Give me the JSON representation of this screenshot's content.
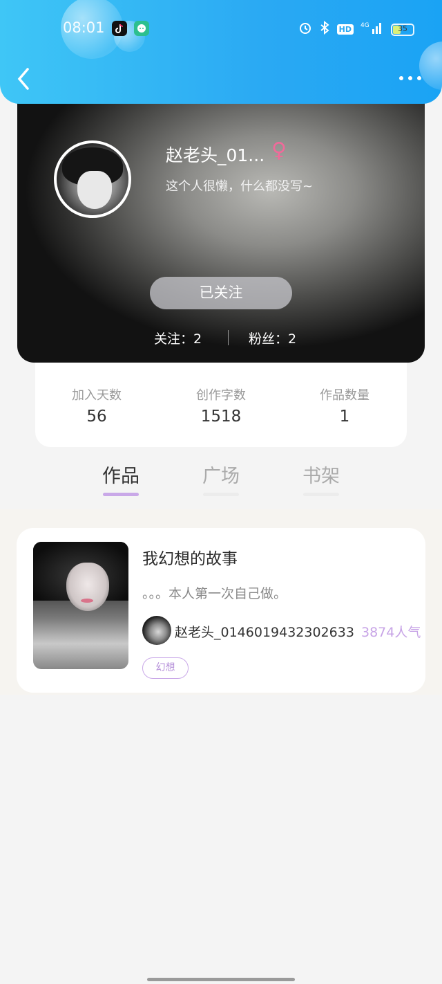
{
  "status_bar": {
    "time": "08:01",
    "hd": "HD",
    "network": "4G",
    "battery": "35"
  },
  "profile": {
    "username": "赵老头_01...",
    "gender_symbol": "♀",
    "bio": "这个人很懒，什么都没写~",
    "follow_button": "已关注",
    "following": "关注：2",
    "followers": "粉丝：2"
  },
  "stats": [
    {
      "label": "加入天数",
      "value": "56"
    },
    {
      "label": "创作字数",
      "value": "1518"
    },
    {
      "label": "作品数量",
      "value": "1"
    }
  ],
  "tabs": [
    {
      "label": "作品",
      "active": true
    },
    {
      "label": "广场",
      "active": false
    },
    {
      "label": "书架",
      "active": false
    }
  ],
  "works": [
    {
      "title": "我幻想的故事",
      "description": "。。。本人第一次自己做。",
      "author": "赵老头_0146019432302633",
      "popularity": "3874人气",
      "tag": "幻想"
    }
  ],
  "colors": {
    "header": "#2aa9f3",
    "accent": "#c7a3e6",
    "gender": "#f06a9a",
    "tab_active_bar": "#c9a8e8"
  }
}
